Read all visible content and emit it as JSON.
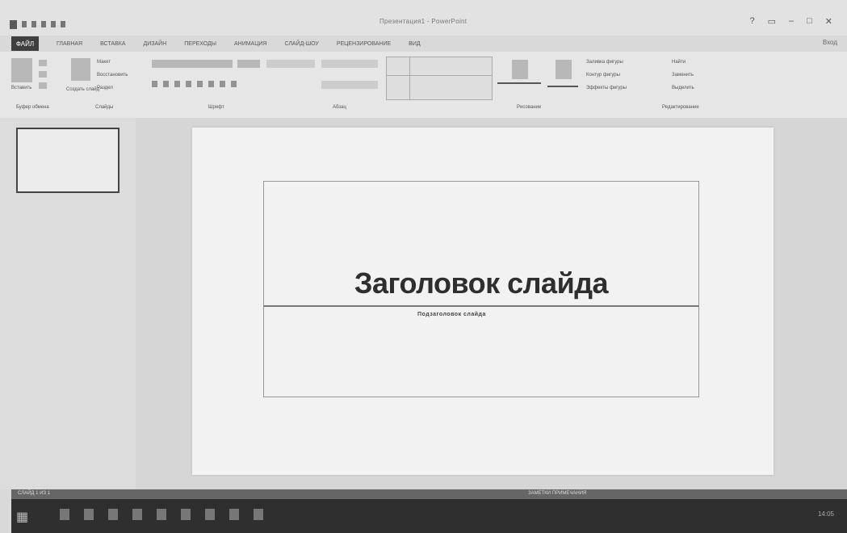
{
  "window": {
    "title": "Презентация1 - PowerPoint",
    "controls": [
      "?",
      "▭",
      "–",
      "□",
      "✕"
    ],
    "user": "Вход"
  },
  "tabs": {
    "file": "ФАЙЛ",
    "items": [
      "ГЛАВНАЯ",
      "ВСТАВКА",
      "ДИЗАЙН",
      "ПЕРЕХОДЫ",
      "АНИМАЦИЯ",
      "СЛАЙД-ШОУ",
      "РЕЦЕНЗИРОВАНИЕ",
      "ВИД"
    ]
  },
  "ribbon": {
    "clipboard": {
      "paste": "Вставить",
      "label": "Буфер обмена"
    },
    "slides": {
      "new": "Создать слайд",
      "layout": "Макет",
      "reset": "Восстановить",
      "section": "Раздел",
      "label": "Слайды"
    },
    "font": {
      "label": "Шрифт"
    },
    "paragraph": {
      "label": "Абзац"
    },
    "drawing": {
      "label": "Рисование",
      "fill": "Заливка фигуры",
      "outline": "Контур фигуры",
      "effects": "Эффекты фигуры"
    },
    "editing": {
      "find": "Найти",
      "replace": "Заменить",
      "select": "Выделить",
      "label": "Редактирование"
    }
  },
  "slide": {
    "title": "Заголовок слайда",
    "subtitle": "Подзаголовок слайда"
  },
  "status": {
    "left": "СЛАЙД 1 ИЗ 1",
    "right": "ЗАМЕТКИ ПРИМЕЧАНИЯ"
  },
  "taskbar": {
    "time": "14:05"
  }
}
